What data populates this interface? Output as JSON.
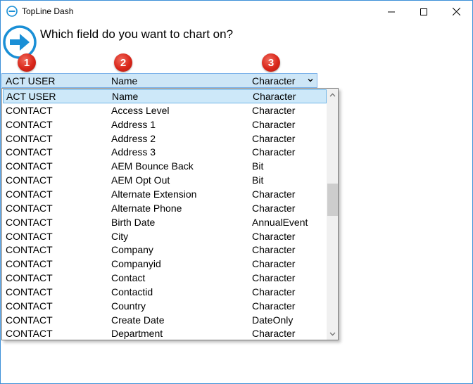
{
  "window": {
    "title": "TopLine Dash"
  },
  "prompt": {
    "question": "Which field do you want to chart on?"
  },
  "badges": [
    "1",
    "2",
    "3"
  ],
  "combo": {
    "table": "ACT USER",
    "field": "Name",
    "type": "Character"
  },
  "rows": [
    {
      "table": "ACT USER",
      "field": "Name",
      "type": "Character"
    },
    {
      "table": "CONTACT",
      "field": "Access Level",
      "type": "Character"
    },
    {
      "table": "CONTACT",
      "field": "Address 1",
      "type": "Character"
    },
    {
      "table": "CONTACT",
      "field": "Address 2",
      "type": "Character"
    },
    {
      "table": "CONTACT",
      "field": "Address 3",
      "type": "Character"
    },
    {
      "table": "CONTACT",
      "field": "AEM Bounce Back",
      "type": "Bit"
    },
    {
      "table": "CONTACT",
      "field": "AEM Opt Out",
      "type": "Bit"
    },
    {
      "table": "CONTACT",
      "field": "Alternate Extension",
      "type": "Character"
    },
    {
      "table": "CONTACT",
      "field": "Alternate Phone",
      "type": "Character"
    },
    {
      "table": "CONTACT",
      "field": "Birth Date",
      "type": "AnnualEvent"
    },
    {
      "table": "CONTACT",
      "field": "City",
      "type": "Character"
    },
    {
      "table": "CONTACT",
      "field": "Company",
      "type": "Character"
    },
    {
      "table": "CONTACT",
      "field": "Companyid",
      "type": "Character"
    },
    {
      "table": "CONTACT",
      "field": "Contact",
      "type": "Character"
    },
    {
      "table": "CONTACT",
      "field": "Contactid",
      "type": "Character"
    },
    {
      "table": "CONTACT",
      "field": "Country",
      "type": "Character"
    },
    {
      "table": "CONTACT",
      "field": "Create Date",
      "type": "DateOnly"
    },
    {
      "table": "CONTACT",
      "field": "Department",
      "type": "Character"
    }
  ],
  "colors": {
    "accent": "#1a8fd6",
    "selection": "#cde8f9",
    "badge": "#d9261a"
  }
}
